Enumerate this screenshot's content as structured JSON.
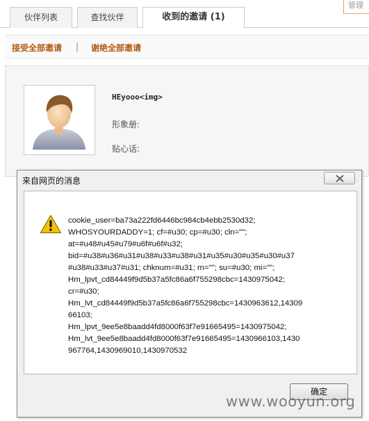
{
  "tabs": [
    {
      "label": "伙伴列表"
    },
    {
      "label": "查找伙伴"
    },
    {
      "label": "收到的邀请 (1)"
    }
  ],
  "corner_box_text": "管理",
  "actions": {
    "accept_all": "接受全部邀请",
    "separator": "|",
    "reject_all": "谢绝全部邀请"
  },
  "invite": {
    "user_name": "HEyooo<img>",
    "album_label": "形象册:",
    "note_label": "贴心话:"
  },
  "dialog": {
    "title": "来自网页的消息",
    "message_lines": [
      "cookie_user=ba73a222fd6446bc984cb4ebb2530d32;",
      "WHOSYOURDADDY=1; cf=#u30; cp=#u30; cln=\"\";",
      "at=#u48#u45#u79#u6f#u6f#u32;",
      "bid=#u38#u36#u31#u38#u33#u38#u31#u35#u30#u35#u30#u37",
      "#u38#u33#u37#u31; chknum=#u31; rn=\"\"; su=#u30; mi=\"\";",
      "Hm_lpvt_cd84449f9d5b37a5fc86a6f755298cbc=1430975042;",
      "cr=#u30;",
      "Hm_lvt_cd84449f9d5b37a5fc86a6f755298cbc=1430963612,14309",
      "66103;",
      "Hm_lpvt_9ee5e8baadd4fd8000f63f7e91665495=1430975042;",
      "Hm_lvt_9ee5e8baadd4fd8000f63f7e91665495=1430966103,1430",
      "967764,1430969010,1430970532"
    ],
    "ok_label": "确定"
  },
  "watermark": "www.wooyun.org",
  "colors": {
    "link_brown": "#b15a10",
    "warning_yellow": "#f5c400"
  }
}
